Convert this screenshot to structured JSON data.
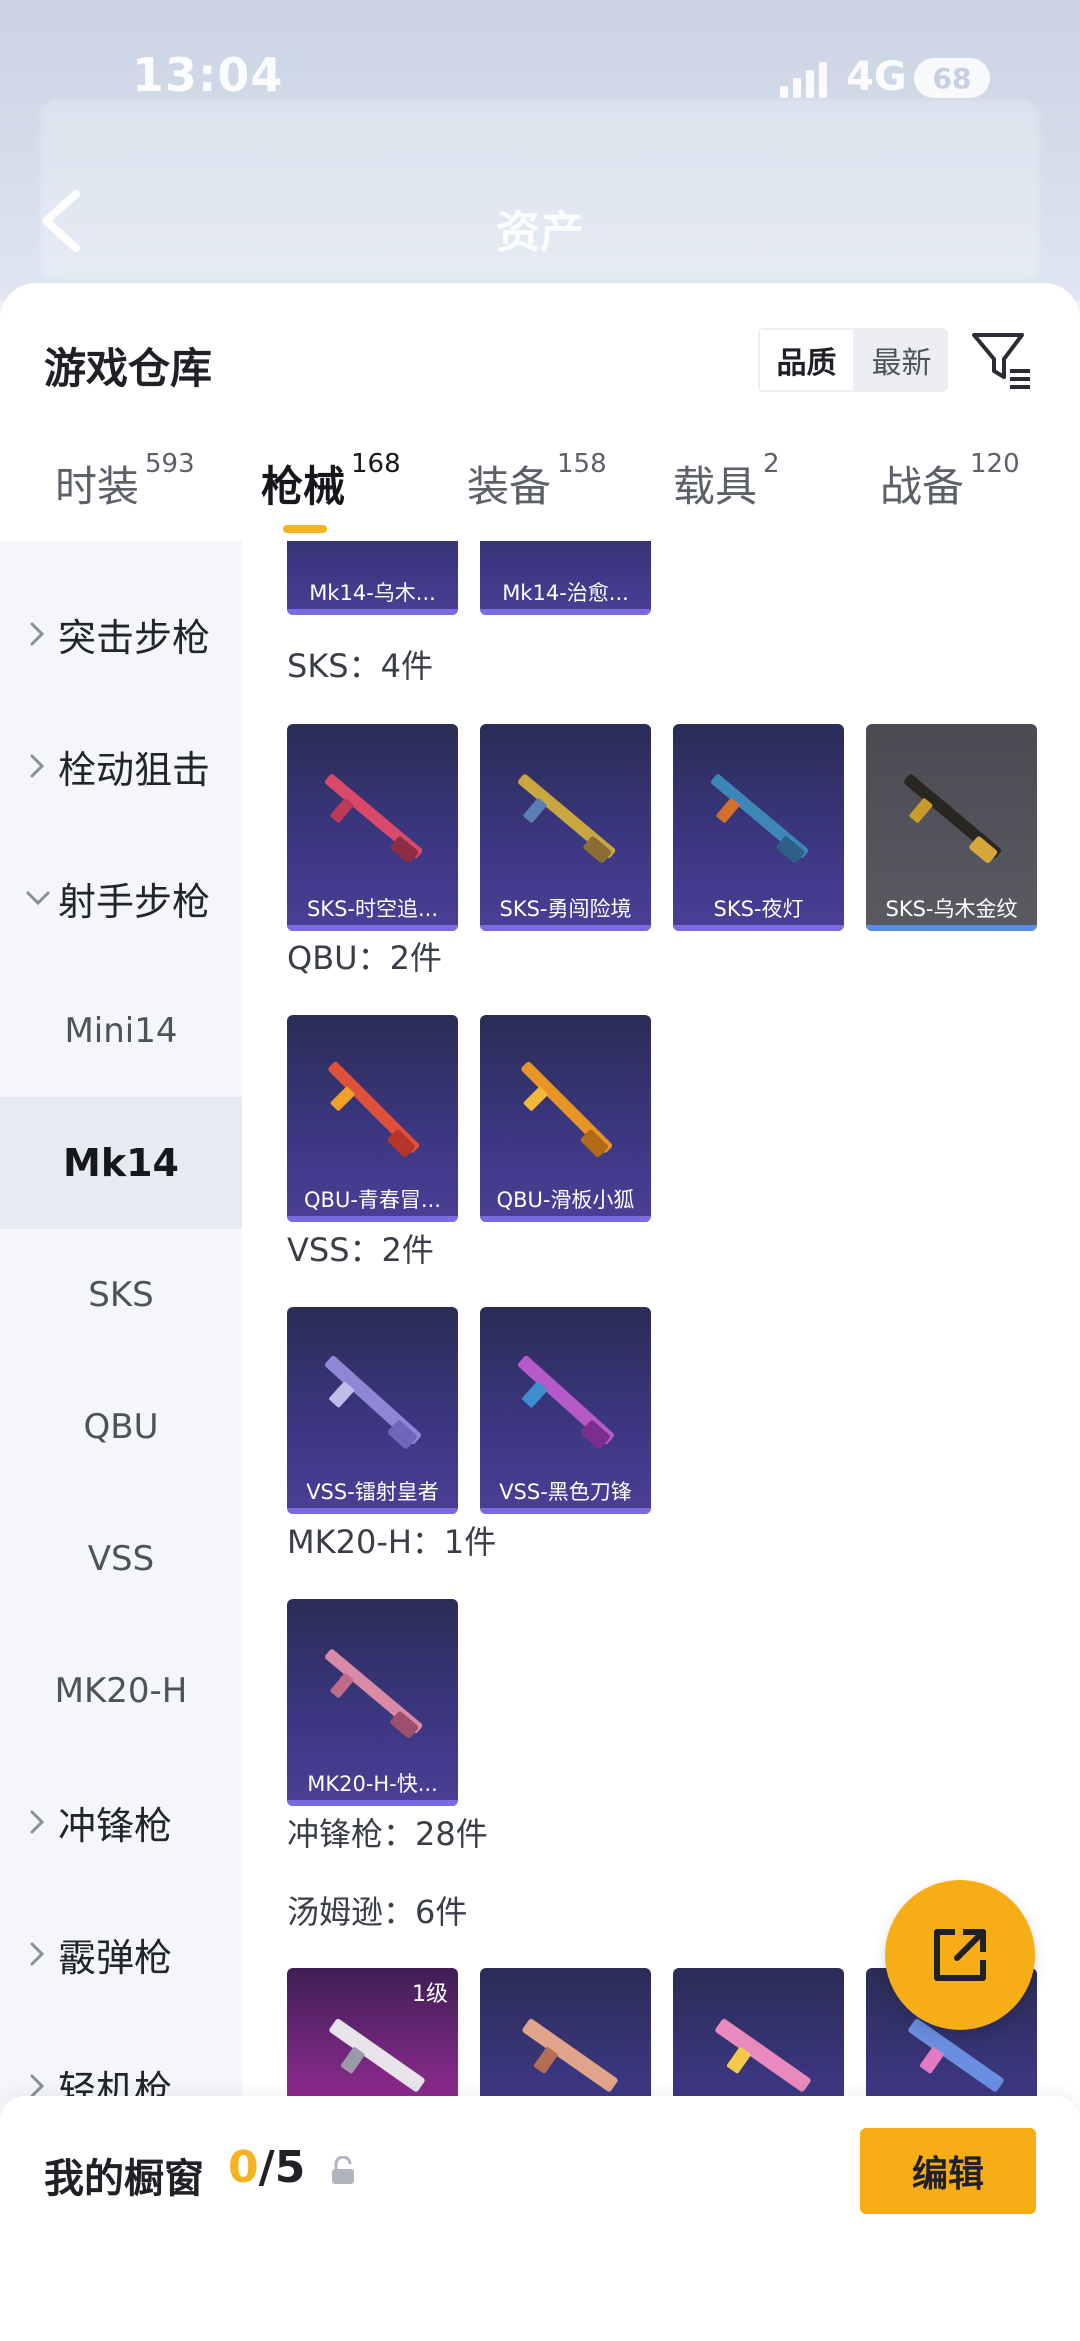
{
  "status_bar": {
    "time": "13:04",
    "network": "4G",
    "battery": "68"
  },
  "nav": {
    "title": "资产"
  },
  "sheet": {
    "title": "游戏仓库",
    "sort_options": [
      {
        "label": "品质"
      },
      {
        "label": "最新"
      }
    ]
  },
  "tabs": [
    {
      "label": "时装",
      "count": "593"
    },
    {
      "label": "枪械",
      "count": "168"
    },
    {
      "label": "装备",
      "count": "158"
    },
    {
      "label": "载具",
      "count": "2"
    },
    {
      "label": "战备",
      "count": "120"
    }
  ],
  "sidebar": {
    "categories": [
      {
        "label": "突击步枪"
      },
      {
        "label": "栓动狙击"
      },
      {
        "label": "射手步枪"
      },
      {
        "label": "冲锋枪"
      },
      {
        "label": "霰弹枪"
      },
      {
        "label": "轻机枪"
      }
    ],
    "subs": [
      {
        "label": "Mini14"
      },
      {
        "label": "Mk14"
      },
      {
        "label": "SKS"
      },
      {
        "label": "QBU"
      },
      {
        "label": "VSS"
      },
      {
        "label": "MK20-H"
      }
    ]
  },
  "content": {
    "top_cards": [
      {
        "name": "Mk14-乌木..."
      },
      {
        "name": "Mk14-治愈..."
      }
    ],
    "groups": [
      {
        "label": "SKS：4件",
        "cards": [
          {
            "name": "SKS-时空追..."
          },
          {
            "name": "SKS-勇闯险境"
          },
          {
            "name": "SKS-夜灯"
          },
          {
            "name": "SKS-乌木金纹"
          }
        ]
      },
      {
        "label": "QBU：2件",
        "cards": [
          {
            "name": "QBU-青春冒..."
          },
          {
            "name": "QBU-滑板小狐"
          }
        ]
      },
      {
        "label": "VSS：2件",
        "cards": [
          {
            "name": "VSS-镭射皇者"
          },
          {
            "name": "VSS-黑色刀锋"
          }
        ]
      },
      {
        "label": "MK20-H：1件",
        "cards": [
          {
            "name": "MK20-H-快..."
          }
        ]
      },
      {
        "label": "冲锋枪：28件"
      },
      {
        "label": "汤姆逊：6件",
        "cards": [
          {
            "level": "1级"
          },
          {},
          {},
          {}
        ]
      }
    ]
  },
  "bottom": {
    "showcase_label": "我的橱窗",
    "count_current": "0",
    "count_total": "/5",
    "edit_label": "编辑"
  },
  "colors": {
    "accent": "#f6b321",
    "card_purple": "#3b3680"
  }
}
